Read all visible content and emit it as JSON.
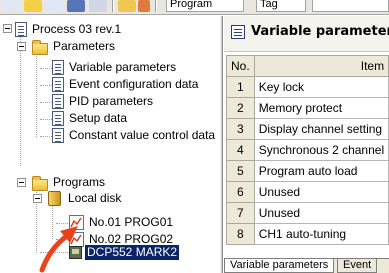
{
  "toolbar": {
    "program_combo": "Program",
    "tag_combo": "Tag"
  },
  "tree": {
    "root": "Process 03 rev.1",
    "parameters_folder": "Parameters",
    "parameters_items": [
      "Variable parameters",
      "Event configuration data",
      "PID parameters",
      "Setup data",
      "Constant value control data"
    ],
    "programs_folder": "Programs",
    "local_disk": "Local disk",
    "programs": [
      "No.01 PROG01",
      "No.02 PROG02"
    ],
    "device": "DCP552 MARK2"
  },
  "panel": {
    "title": "Variable parameters",
    "col_no": "No.",
    "col_item": "Item",
    "rows": [
      {
        "no": "1",
        "item": "Key lock"
      },
      {
        "no": "2",
        "item": "Memory protect"
      },
      {
        "no": "3",
        "item": "Display channel setting"
      },
      {
        "no": "4",
        "item": "Synchronous 2 channel"
      },
      {
        "no": "5",
        "item": "Program auto load"
      },
      {
        "no": "6",
        "item": "Unused"
      },
      {
        "no": "7",
        "item": "Unused"
      },
      {
        "no": "8",
        "item": "CH1 auto-tuning"
      }
    ]
  },
  "sheet_tabs": {
    "active": "Variable parameters",
    "inactive": "Event"
  },
  "annotation": {
    "arrow_color": "#e8431a"
  }
}
